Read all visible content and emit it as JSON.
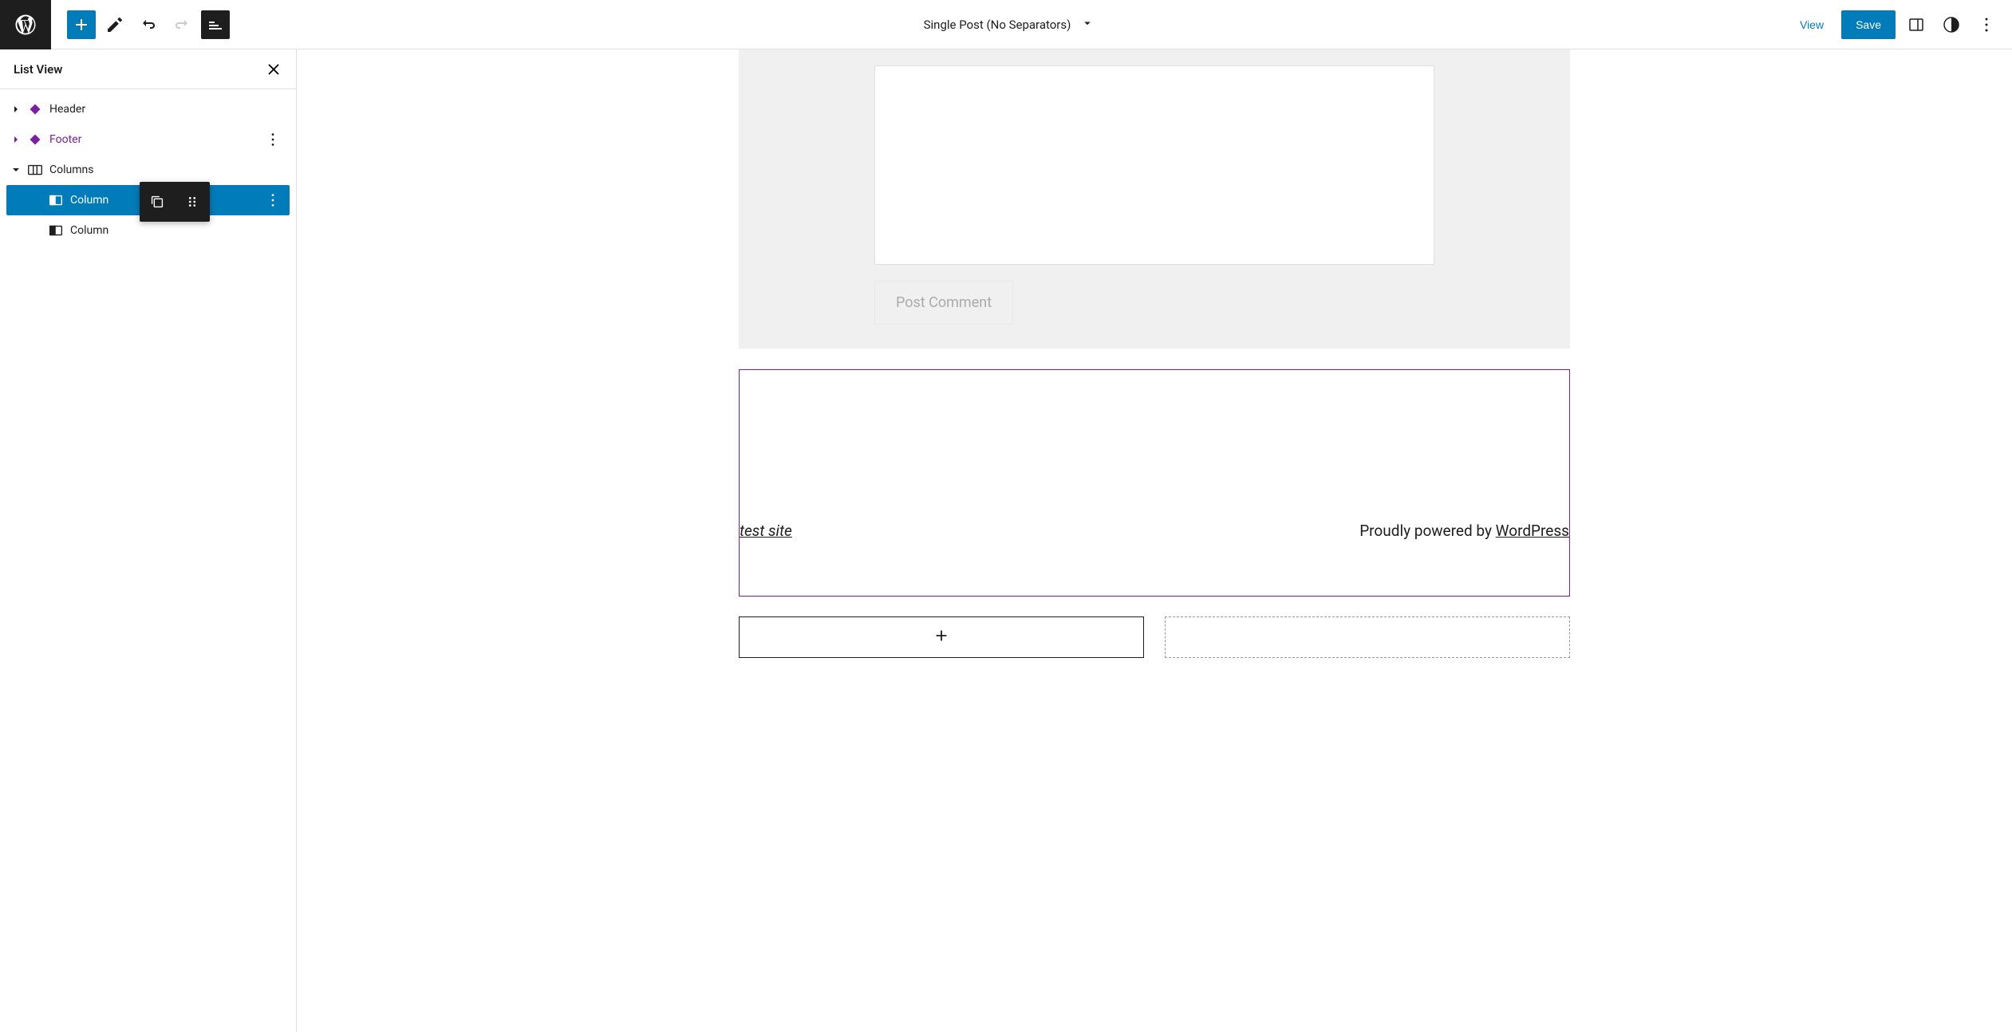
{
  "header": {
    "document_title": "Single Post (No Separators)",
    "view_label": "View",
    "save_label": "Save"
  },
  "list_view": {
    "title": "List View",
    "items": {
      "header": "Header",
      "footer": "Footer",
      "columns": "Columns",
      "column1": "Column",
      "column2": "Column"
    }
  },
  "canvas": {
    "post_comment_label": "Post Comment",
    "site_title": "test site",
    "powered_prefix": "Proudly powered by ",
    "powered_link": "WordPress"
  }
}
